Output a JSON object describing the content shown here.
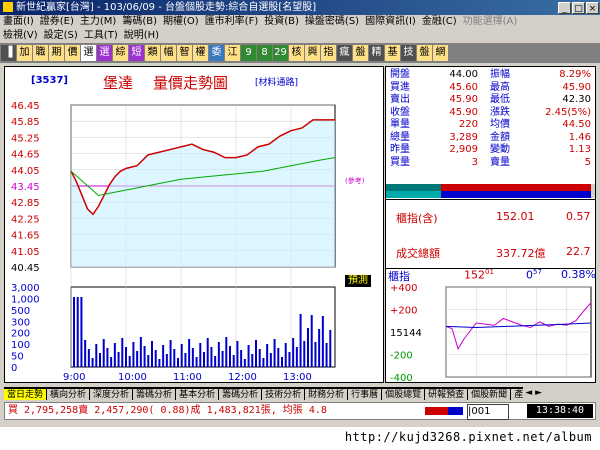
{
  "window": {
    "title": "新世紀贏家[台灣] - 103/06/09 - 台盤個股走勢:綜合自選股[名望股]",
    "buttons": [
      "_",
      "□",
      "×"
    ]
  },
  "menu": {
    "row1": [
      "畫面(I)",
      "證券(E)",
      "主力(M)",
      "籌碼(B)",
      "期權(O)",
      "匯市利率(F)",
      "投資(B)",
      "操盤密碼(S)",
      "國際資訊(I)",
      "金融(C)",
      "功能選擇(A)"
    ],
    "row1_disabled": [
      "功能選擇(A)"
    ],
    "row2": [
      "檢視(V)",
      "設定(S)",
      "工具(T)",
      "說明(H)"
    ]
  },
  "toolbar": {
    "buttons": [
      {
        "label": "▐",
        "style": "dark"
      },
      {
        "label": "加",
        "style": ""
      },
      {
        "label": "職",
        "style": ""
      },
      {
        "label": "期",
        "style": ""
      },
      {
        "label": "價",
        "style": ""
      },
      {
        "label": "選",
        "style": "sel"
      },
      {
        "label": "選",
        "style": "purple"
      },
      {
        "label": "綜",
        "style": ""
      },
      {
        "label": "短",
        "style": "purple"
      },
      {
        "label": "類",
        "style": ""
      },
      {
        "label": "幅",
        "style": ""
      },
      {
        "label": "智",
        "style": ""
      },
      {
        "label": "權",
        "style": ""
      },
      {
        "label": "委",
        "style": "blue"
      },
      {
        "label": "江",
        "style": ""
      },
      {
        "label": "9",
        "style": "green"
      },
      {
        "label": "8",
        "style": "green"
      },
      {
        "label": "29",
        "style": "green"
      },
      {
        "label": "核",
        "style": ""
      },
      {
        "label": "興",
        "style": ""
      },
      {
        "label": "指",
        "style": ""
      },
      {
        "label": "瘋",
        "style": "dark"
      },
      {
        "label": "盤",
        "style": ""
      },
      {
        "label": "精",
        "style": "dark"
      },
      {
        "label": "基",
        "style": ""
      },
      {
        "label": "技",
        "style": "dark"
      },
      {
        "label": "盤",
        "style": ""
      },
      {
        "label": "網",
        "style": ""
      }
    ]
  },
  "chart_header": {
    "code": "[3537]",
    "name": "堡達",
    "title": "量價走勢圖",
    "sector": "[材料通路]",
    "ref_label": "(參考)",
    "vol_btn": "預測"
  },
  "chart_data": [
    {
      "type": "line",
      "title": "量價走勢圖",
      "price_ticks": [
        "46.45",
        "45.85",
        "45.25",
        "44.65",
        "44.05",
        "43.45",
        "42.85",
        "42.25",
        "41.65",
        "41.05",
        "40.45"
      ],
      "volume_ticks": [
        "3,000",
        "1,000",
        "500",
        "300",
        "200",
        "100",
        "50",
        "0"
      ],
      "time_ticks": [
        "9:00",
        "10:00",
        "11:00",
        "12:00",
        "13:00"
      ],
      "ylim": [
        40.45,
        46.45
      ],
      "reference_price": 43.45,
      "series": [
        {
          "color": "#cc0000",
          "x": [
            0,
            0.1,
            0.2,
            0.3,
            0.4,
            0.5,
            0.6,
            0.7,
            0.8,
            0.9,
            1.0,
            1.2,
            1.4,
            1.6,
            1.8,
            2.0,
            2.2,
            2.4,
            2.6,
            2.8,
            3.0,
            3.2,
            3.4,
            3.6,
            3.8,
            4.0,
            4.2,
            4.4,
            4.6,
            4.8
          ],
          "values": [
            44.0,
            43.6,
            43.1,
            42.6,
            42.4,
            42.7,
            43.1,
            43.5,
            43.8,
            44.0,
            44.1,
            44.2,
            44.6,
            44.7,
            44.8,
            44.9,
            45.0,
            44.8,
            44.7,
            44.5,
            44.5,
            44.6,
            44.9,
            45.0,
            45.3,
            45.5,
            45.6,
            45.9,
            45.9,
            45.9
          ]
        },
        {
          "color": "#00aa00",
          "x": [
            0,
            0.5,
            1.0,
            1.5,
            2.0,
            2.5,
            3.0,
            3.5,
            4.0,
            4.5,
            4.8
          ],
          "values": [
            44.0,
            43.1,
            43.3,
            43.5,
            43.7,
            43.8,
            43.9,
            44.0,
            44.2,
            44.4,
            44.5
          ]
        }
      ]
    },
    {
      "type": "line",
      "title": "櫃指",
      "series": [
        {
          "color": "#cc00cc",
          "x": [
            0,
            0.2,
            0.4,
            0.6,
            0.8,
            1.0,
            1.3,
            1.6,
            1.9,
            2.2,
            2.5,
            2.8,
            3.1,
            3.4,
            3.7,
            4.0,
            4.3,
            4.6,
            4.8
          ],
          "values": [
            50,
            30,
            -150,
            -60,
            10,
            80,
            70,
            60,
            120,
            90,
            60,
            40,
            90,
            50,
            70,
            60,
            100,
            200,
            260
          ]
        },
        {
          "color": "#0000cc",
          "x": [
            0,
            1.0,
            2.0,
            3.0,
            4.0,
            4.8
          ],
          "values": [
            50,
            40,
            50,
            60,
            70,
            80
          ]
        }
      ],
      "ticks": [
        "+400",
        "+200",
        "15144",
        "-200",
        "-400"
      ],
      "ylim": [
        -400,
        400
      ]
    }
  ],
  "quote": {
    "rows": [
      {
        "l1": "開盤",
        "v1": "44.00",
        "l2": "振幅",
        "v2": "8.29%",
        "c1": "blk",
        "c2": "red"
      },
      {
        "l1": "買進",
        "v1": "45.60",
        "l2": "最高",
        "v2": "45.90",
        "c1": "red",
        "c2": "red"
      },
      {
        "l1": "賣出",
        "v1": "45.90",
        "l2": "最低",
        "v2": "42.30",
        "c1": "red",
        "c2": "blk"
      },
      {
        "l1": "收盤",
        "v1": "45.90",
        "l2": "漲跌",
        "v2": "2.45(5%)",
        "c1": "red",
        "c2": "red"
      },
      {
        "l1": "單量",
        "v1": "220",
        "l2": "均價",
        "v2": "44.50",
        "c1": "red",
        "c2": "red"
      },
      {
        "l1": "總量",
        "v1": "3,289",
        "l2": "金額",
        "v2": "1.46",
        "c1": "red",
        "c2": "red"
      },
      {
        "l1": "昨量",
        "v1": "2,909",
        "l2": "變動",
        "v2": "1.13",
        "c1": "red",
        "c2": "red"
      },
      {
        "l1": "買量",
        "v1": "3",
        "l2": "賣量",
        "v2": "5",
        "c1": "red",
        "c2": "red"
      }
    ]
  },
  "otc": {
    "label": "櫃指(含)",
    "value": "152.01",
    "change": "0.57",
    "turnover_label": "成交總額",
    "turnover": "337.72億",
    "turnover_change": "22.7",
    "mini_label": "櫃指",
    "mini_val1": "152",
    "mini_val1b": "01",
    "mini_val2": "0",
    "mini_val2b": "57",
    "mini_pct": "0.38%"
  },
  "tabs": [
    {
      "label": "當日走勢",
      "active": true
    },
    {
      "label": "橫向分析",
      "active": false
    },
    {
      "label": "深度分析",
      "active": false
    },
    {
      "label": "籌碼分析",
      "active": false
    },
    {
      "label": "基本分析",
      "active": false
    },
    {
      "label": "籌碼分析",
      "active": false
    },
    {
      "label": "技術分析",
      "active": false
    },
    {
      "label": "財務分析",
      "active": false
    },
    {
      "label": "行事曆",
      "active": false
    },
    {
      "label": "個股總覽",
      "active": false
    },
    {
      "label": "研報預查",
      "active": false
    },
    {
      "label": "個股新聞",
      "active": false
    },
    {
      "label": "產業分析",
      "active": false
    }
  ],
  "status": {
    "text": "買 2,795,258賣 2,457,290( 0.88)成 1,483,821張, 均張 4.8",
    "code": "|001",
    "time": "13:38:40"
  },
  "url": "http://kujd3268.pixnet.net/album"
}
